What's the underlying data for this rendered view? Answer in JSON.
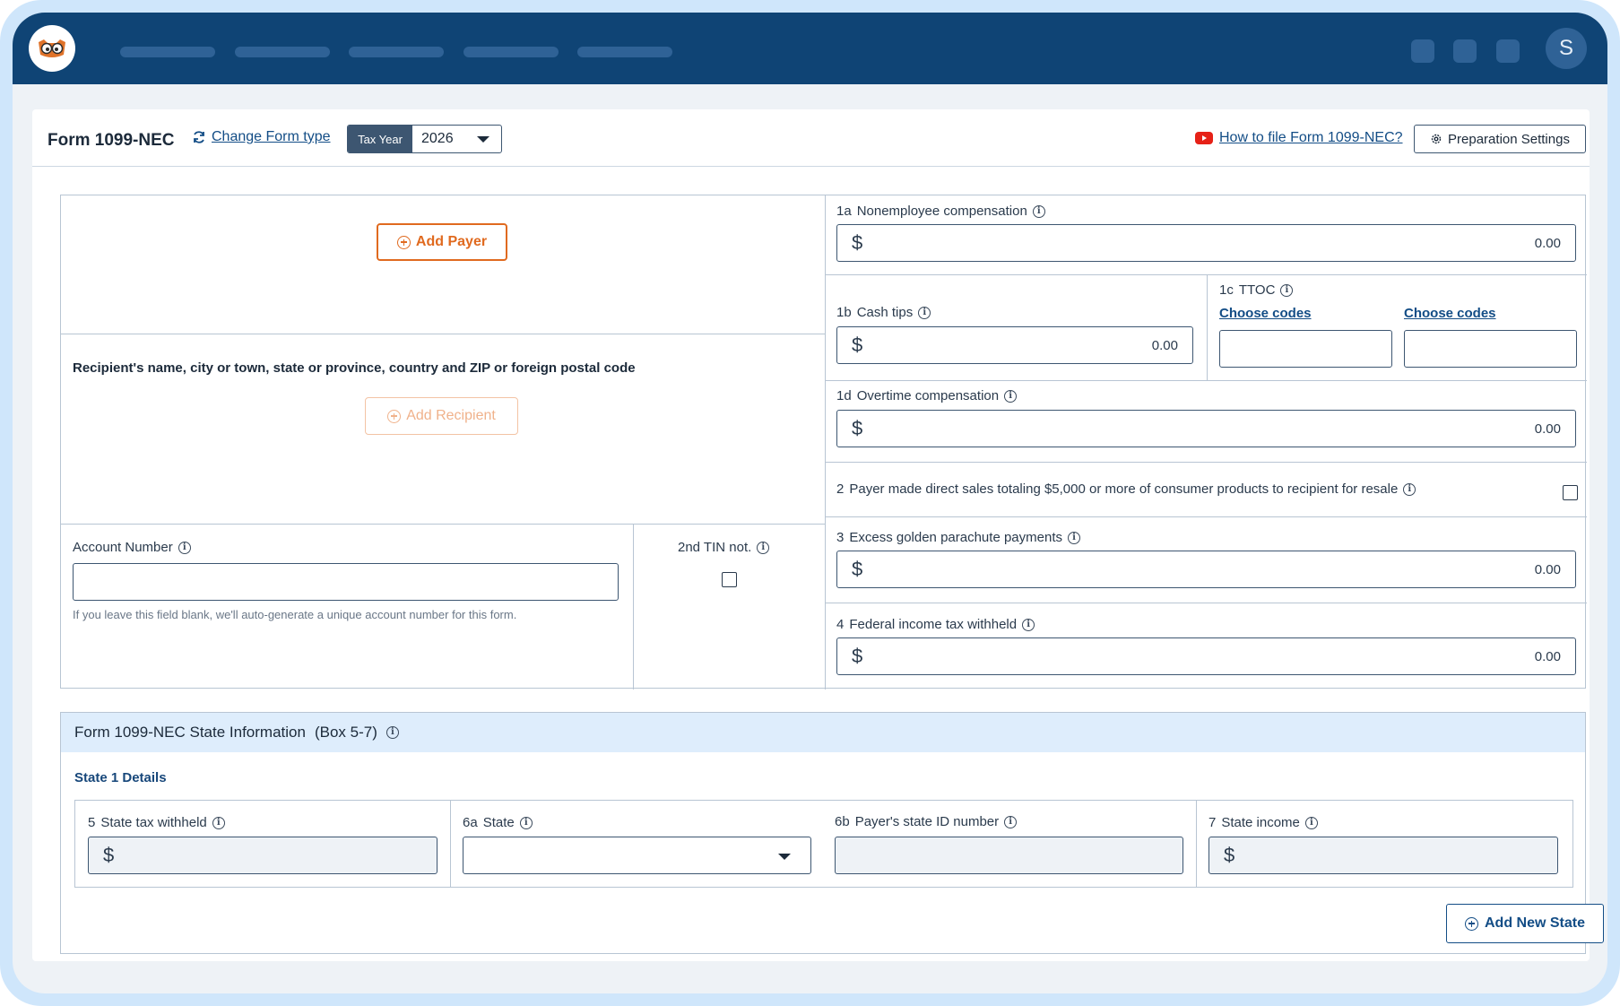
{
  "app": {
    "avatar_initial": "S",
    "brand_color": "#0f4475",
    "accent_color": "#e06a1f"
  },
  "header": {
    "form_title": "Form 1099-NEC",
    "change_form_type": "Change Form type",
    "tax_year_label": "Tax Year",
    "tax_year_value": "2026",
    "how_to_link": "How to file Form 1099-NEC?",
    "preparation_settings": "Preparation Settings"
  },
  "payer": {
    "add_payer_label": "Add Payer"
  },
  "recipient": {
    "heading": "Recipient's name, city or town, state or province, country and ZIP or foreign postal code",
    "add_recipient_label": "Add Recipient"
  },
  "account": {
    "label": "Account Number",
    "value": "",
    "hint": "If you leave this field blank, we'll auto-generate a unique account number for this form."
  },
  "tin": {
    "label": "2nd TIN not."
  },
  "boxes": {
    "b1a": {
      "num": "1a",
      "label": "Nonemployee compensation",
      "currency": "$",
      "value": "0.00"
    },
    "b1b": {
      "num": "1b",
      "label": "Cash tips",
      "currency": "$",
      "value": "0.00"
    },
    "b1c": {
      "num": "1c",
      "label": "TTOC",
      "choose_codes_1": "Choose codes",
      "choose_codes_2": "Choose codes"
    },
    "b1d": {
      "num": "1d",
      "label": "Overtime compensation",
      "currency": "$",
      "value": "0.00"
    },
    "b2": {
      "num": "2",
      "label": "Payer made direct sales totaling $5,000 or more of consumer products to recipient for resale"
    },
    "b3": {
      "num": "3",
      "label": "Excess golden parachute payments",
      "currency": "$",
      "value": "0.00"
    },
    "b4": {
      "num": "4",
      "label": "Federal income tax withheld",
      "currency": "$",
      "value": "0.00"
    }
  },
  "state_info": {
    "title": "Form 1099-NEC State Information",
    "boxes_range": "(Box 5-7)",
    "subtitle": "State 1 Details",
    "b5": {
      "num": "5",
      "label": "State tax withheld",
      "currency": "$"
    },
    "b6a": {
      "num": "6a",
      "label": "State",
      "value": ""
    },
    "b6b": {
      "num": "6b",
      "label": "Payer's state ID number"
    },
    "b7": {
      "num": "7",
      "label": "State income",
      "currency": "$"
    },
    "add_new_state": "Add New State"
  }
}
